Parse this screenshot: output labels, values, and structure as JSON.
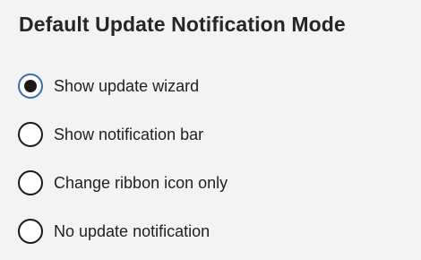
{
  "section": {
    "title": "Default Update Notification Mode"
  },
  "options": [
    {
      "label": "Show update wizard",
      "checked": true
    },
    {
      "label": "Show notification bar",
      "checked": false
    },
    {
      "label": "Change ribbon icon only",
      "checked": false
    },
    {
      "label": "No update notification",
      "checked": false
    }
  ],
  "colors": {
    "background": "#f3f3f3",
    "text": "#1f1f1f",
    "selected_ring": "#3a6ea8",
    "radio_dot": "#1a1a1a"
  }
}
